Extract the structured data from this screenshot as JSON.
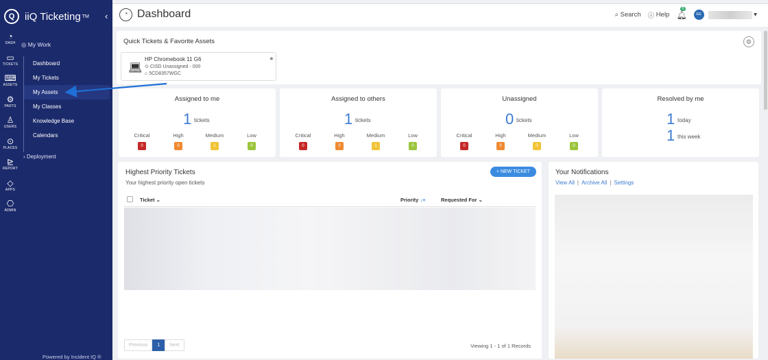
{
  "brand": {
    "logo": "Q",
    "name": "iiQ Ticketing",
    "tm": "TM"
  },
  "rail": [
    {
      "icon": "◔",
      "label": "DASH",
      "name": "dash"
    },
    {
      "icon": "▭",
      "label": "TICKETS",
      "name": "tickets"
    },
    {
      "icon": "⌨",
      "label": "ASSETS",
      "name": "assets"
    },
    {
      "icon": "⚙",
      "label": "PARTS",
      "name": "parts"
    },
    {
      "icon": "♙",
      "label": "USERS",
      "name": "users"
    },
    {
      "icon": "⊙",
      "label": "PLACES",
      "name": "places"
    },
    {
      "icon": "⊵",
      "label": "REPORT",
      "name": "report"
    },
    {
      "icon": "◇",
      "label": "APPS",
      "name": "apps"
    },
    {
      "icon": "⎔",
      "label": "ADMIN",
      "name": "admin"
    }
  ],
  "sidebar": {
    "mywork": "My Work",
    "items": [
      "Dashboard",
      "My Tickets",
      "My Assets",
      "My Classes",
      "Knowledge Base",
      "Calendars"
    ],
    "active_index": 2,
    "deployment": "Deployment",
    "powered": "Powered by Incident IQ ®"
  },
  "header": {
    "title": "Dashboard",
    "search": "Search",
    "help": "Help",
    "bell_count": "6",
    "avatar": "EE"
  },
  "quick": {
    "title": "Quick Tickets & Favorite Assets",
    "asset": {
      "name": "HP Chromebook 11 G6",
      "location": "CISD Unassigned - 000",
      "tag": "5CD8357WGC"
    }
  },
  "stats": [
    {
      "title": "Assigned to me",
      "value": "1",
      "unit": "tickets",
      "levels": [
        "0",
        "0",
        "1",
        "0"
      ]
    },
    {
      "title": "Assigned to others",
      "value": "1",
      "unit": "tickets",
      "levels": [
        "0",
        "0",
        "1",
        "0"
      ]
    },
    {
      "title": "Unassigned",
      "value": "0",
      "unit": "tickets",
      "levels": [
        "0",
        "0",
        "0",
        "0"
      ]
    }
  ],
  "resolved": {
    "title": "Resolved by me",
    "today_value": "1",
    "today_label": "today",
    "week_value": "1",
    "week_label": "this week"
  },
  "levels": {
    "labels": [
      "Critical",
      "High",
      "Medium",
      "Low"
    ],
    "colors": [
      "#c62828",
      "#ef8a32",
      "#f2c438",
      "#9bc53d"
    ]
  },
  "priority": {
    "title": "Highest Priority Tickets",
    "subtitle": "Your highest priority open tickets",
    "new_ticket": "+ NEW TICKET",
    "col_ticket": "Ticket",
    "col_priority": "Priority",
    "col_requested": "Requested For",
    "prev": "Previous",
    "page": "1",
    "next": "Next",
    "viewing": "Viewing 1 - 1 of 1 Records"
  },
  "notifications": {
    "title": "Your Notifications",
    "view_all": "View All",
    "archive_all": "Archive All",
    "settings": "Settings"
  }
}
